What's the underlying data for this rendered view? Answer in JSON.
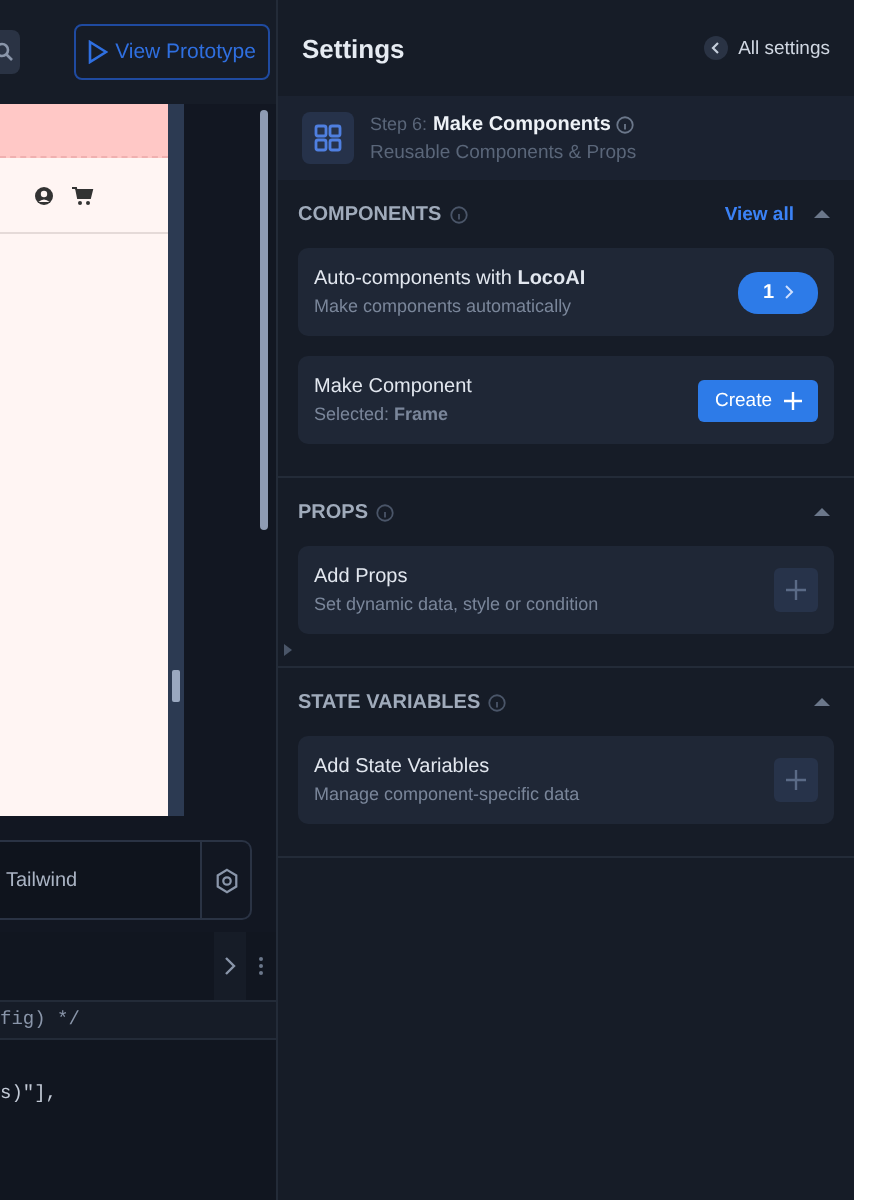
{
  "toolbar": {
    "view_prototype": "View Prototype"
  },
  "style_field": {
    "value": "Tailwind"
  },
  "code_lines": [
    "fig) */",
    "s)\"],"
  ],
  "settings": {
    "title": "Settings",
    "all_settings": "All settings",
    "step": {
      "prefix": "Step 6:",
      "title": "Make Components",
      "subtitle": "Reusable Components & Props"
    },
    "sections": [
      {
        "title": "COMPONENTS",
        "link": "View all",
        "expanded": true,
        "cards": [
          {
            "kind": "badge",
            "title": "Auto-components with **LocoAI**",
            "subtitle": "Make components automatically",
            "badge": "1"
          },
          {
            "kind": "button",
            "title": "Make Component",
            "subtitle": "Selected: **Frame**",
            "button": "Create"
          }
        ]
      },
      {
        "title": "PROPS",
        "expanded": true,
        "cards": [
          {
            "kind": "add",
            "title": "Add Props",
            "subtitle": "Set dynamic data, style or condition"
          }
        ]
      },
      {
        "title": "STATE VARIABLES",
        "expanded": true,
        "cards": [
          {
            "kind": "add",
            "title": "Add State Variables",
            "subtitle": "Manage component-specific data"
          }
        ]
      }
    ]
  }
}
